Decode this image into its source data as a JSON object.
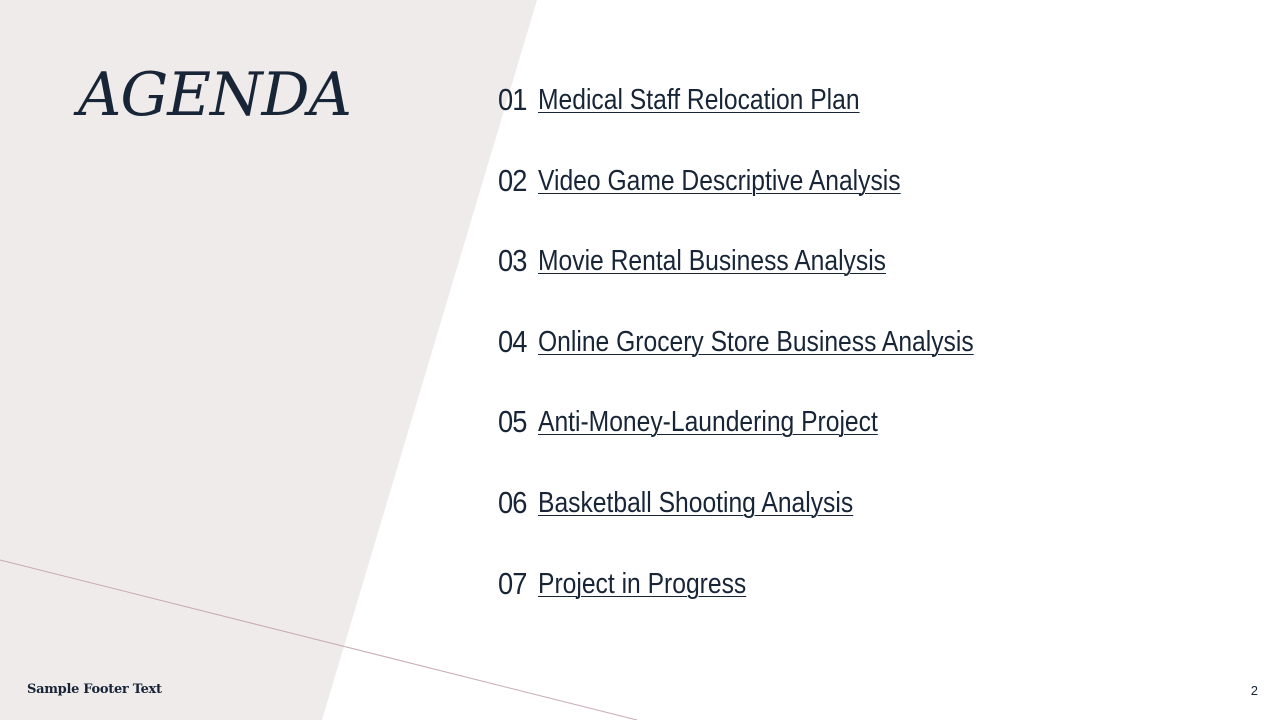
{
  "slide": {
    "title": "AGENDA",
    "items": [
      {
        "number": "01",
        "label": "Medical Staff Relocation Plan"
      },
      {
        "number": "02",
        "label": "Video Game Descriptive Analysis"
      },
      {
        "number": "03",
        "label": "Movie Rental Business Analysis"
      },
      {
        "number": "04",
        "label": "Online Grocery Store Business Analysis"
      },
      {
        "number": "05",
        "label": "Anti-Money-Laundering Project"
      },
      {
        "number": "06",
        "label": "Basketball Shooting Analysis"
      },
      {
        "number": "07",
        "label": "Project in Progress"
      }
    ],
    "footer": "Sample Footer Text",
    "page_number": "2"
  },
  "colors": {
    "background": "#ffffff",
    "panel": "#efebea",
    "text": "#182537",
    "accent_line": "#c9a9b2"
  }
}
